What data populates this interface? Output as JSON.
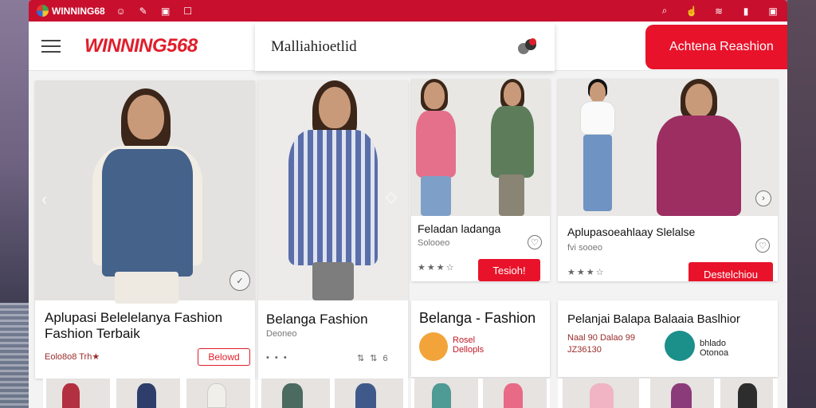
{
  "statusbar": {
    "app_name": "WINNING68",
    "left_icons": [
      "chat-icon",
      "wand-icon",
      "message-icon",
      "edit-icon"
    ],
    "right_icons": [
      "search-icon",
      "hand-icon",
      "wifi-icon",
      "battery-icon",
      "lock-icon"
    ]
  },
  "header": {
    "brand": "WINNING568",
    "search_value": "Malliahioetlid",
    "cta_label": "Achtena Reashion"
  },
  "colors": {
    "brand": "#e01e2b",
    "accent": "#e8132a",
    "status_bar": "#c8102e"
  },
  "cards": [
    {
      "title": "Aplupasi Belelelanya Fashion Fashion Terbaik",
      "meta": "Eolo8o8  Trh★",
      "button": "Belowd"
    },
    {
      "title": "Belanga Fashion",
      "meta": "Deoneo",
      "stars": "• • •",
      "icons": "⇅ ⇅ 6"
    },
    {
      "title": "Belanga - Fashion",
      "badge_text": "Rosel\nDellopls"
    },
    {
      "title": "Pelanjai Balapa Balaaia Baslhior",
      "meta": "Naal 90 Dalao  99 JZ36130",
      "badge_text": "bhlado\nOtonoa"
    },
    {
      "title": "Feladan ladanga",
      "meta": "Solooeo",
      "stars": "★★★☆",
      "button": "Tesioh!"
    },
    {
      "title": "Aplupasoeahlaay Slelalse",
      "meta": "fvi sooeo",
      "stars": "★★★☆",
      "button": "Destelchiou"
    }
  ]
}
